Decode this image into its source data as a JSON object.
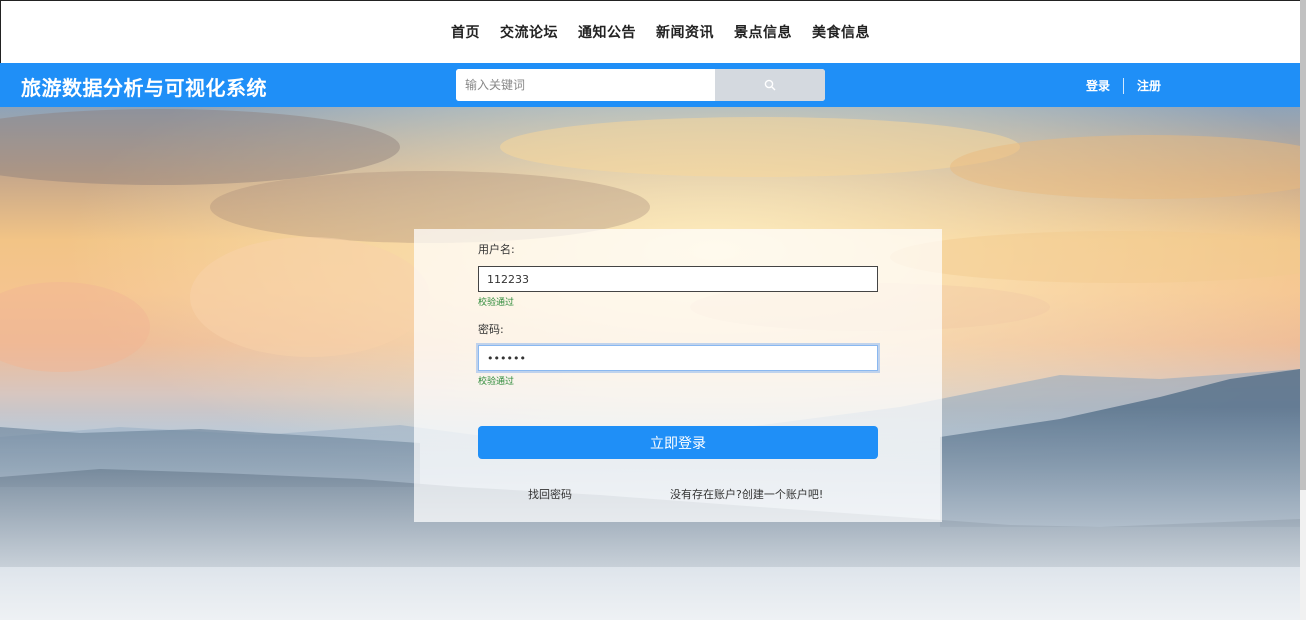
{
  "nav": {
    "items": [
      {
        "label": "首页"
      },
      {
        "label": "交流论坛"
      },
      {
        "label": "通知公告"
      },
      {
        "label": "新闻资讯"
      },
      {
        "label": "景点信息"
      },
      {
        "label": "美食信息"
      }
    ]
  },
  "header": {
    "title": "旅游数据分析与可视化系统",
    "search_placeholder": "输入关键词",
    "search_icon": "search-icon",
    "login_label": "登录",
    "register_label": "注册",
    "accent_color": "#1f8ff7"
  },
  "login": {
    "username_label": "用户名:",
    "username_value": "112233",
    "username_status": "校验通过",
    "password_label": "密码:",
    "password_value": "••••••",
    "password_status": "校验通过",
    "submit_label": "立即登录",
    "forgot_label": "找回密码",
    "register_prompt": "没有存在账户?创建一个账户吧!"
  }
}
